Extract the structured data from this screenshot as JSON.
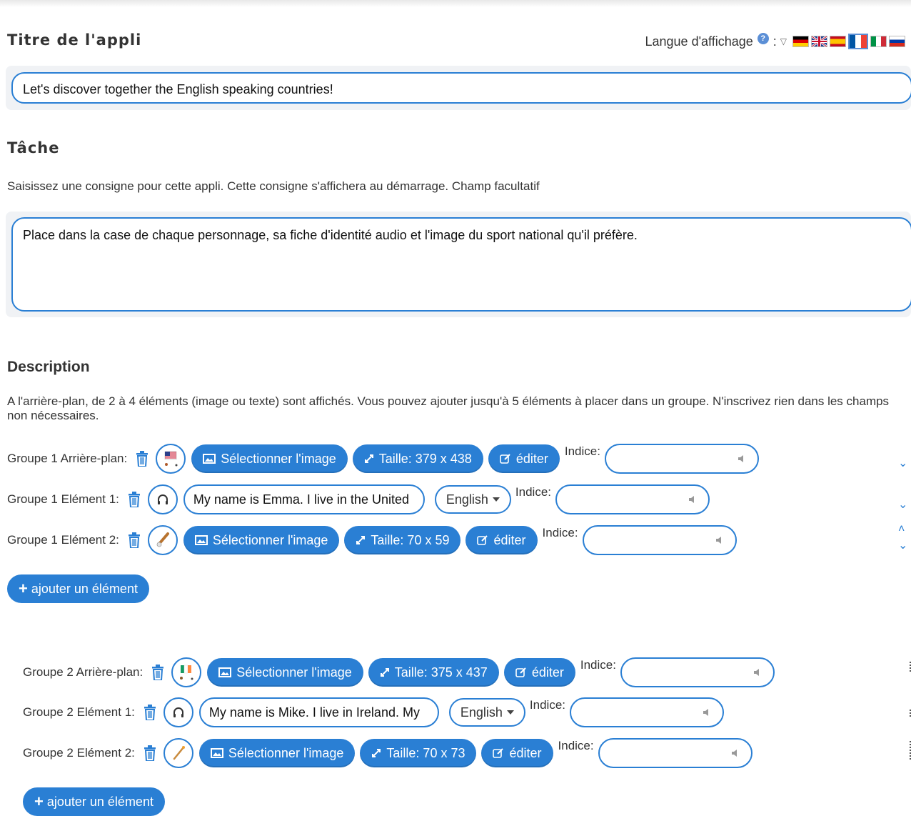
{
  "app_title": {
    "heading": "Titre de l'appli",
    "value": "Let's discover together the English speaking countries!"
  },
  "language": {
    "label": "Langue d'affichage",
    "help": "?",
    "colon": ":",
    "flags": [
      "german-flag",
      "uk-flag",
      "spanish-flag",
      "french-flag",
      "italian-flag",
      "russian-flag"
    ],
    "selected": "french-flag"
  },
  "task": {
    "heading": "Tâche",
    "hint": "Saisissez une consigne pour cette appli. Cette consigne s'affichera au démarrage. Champ facultatif",
    "value": "Place dans la case de chaque personnage, sa fiche d'identité audio et l'image du sport national qu'il préfère."
  },
  "description": {
    "heading": "Description",
    "text": "A l'arrière-plan, de 2 à 4 éléments (image ou texte) sont affichés. Vous pouvez ajouter jusqu'à 5 éléments à placer dans un groupe. N'inscrivez rien dans les champs non nécessaires."
  },
  "common": {
    "select_image": "Sélectionner l'image",
    "edit": "éditer",
    "hint_label": "Indice:",
    "add_element": "ajouter un élément"
  },
  "group1": {
    "background": {
      "label": "Groupe 1 Arrière-plan:",
      "size": "Taille: 379 x 438"
    },
    "element1": {
      "label": "Groupe 1 Elément 1:",
      "text": "My name is Emma. I live in the United",
      "lang": "English"
    },
    "element2": {
      "label": "Groupe 1 Elément 2:",
      "size": "Taille: 70 x 59"
    }
  },
  "group2": {
    "background": {
      "label": "Groupe 2 Arrière-plan:",
      "size": "Taille: 375 x 437"
    },
    "element1": {
      "label": "Groupe 2 Elément 1:",
      "text": "My name is Mike. I live in Ireland. My",
      "lang": "English"
    },
    "element2": {
      "label": "Groupe 2 Elément 2:",
      "size": "Taille: 70 x 73"
    }
  },
  "colors": {
    "accent": "#2a7fd4",
    "panel": "#f0f2f5"
  }
}
